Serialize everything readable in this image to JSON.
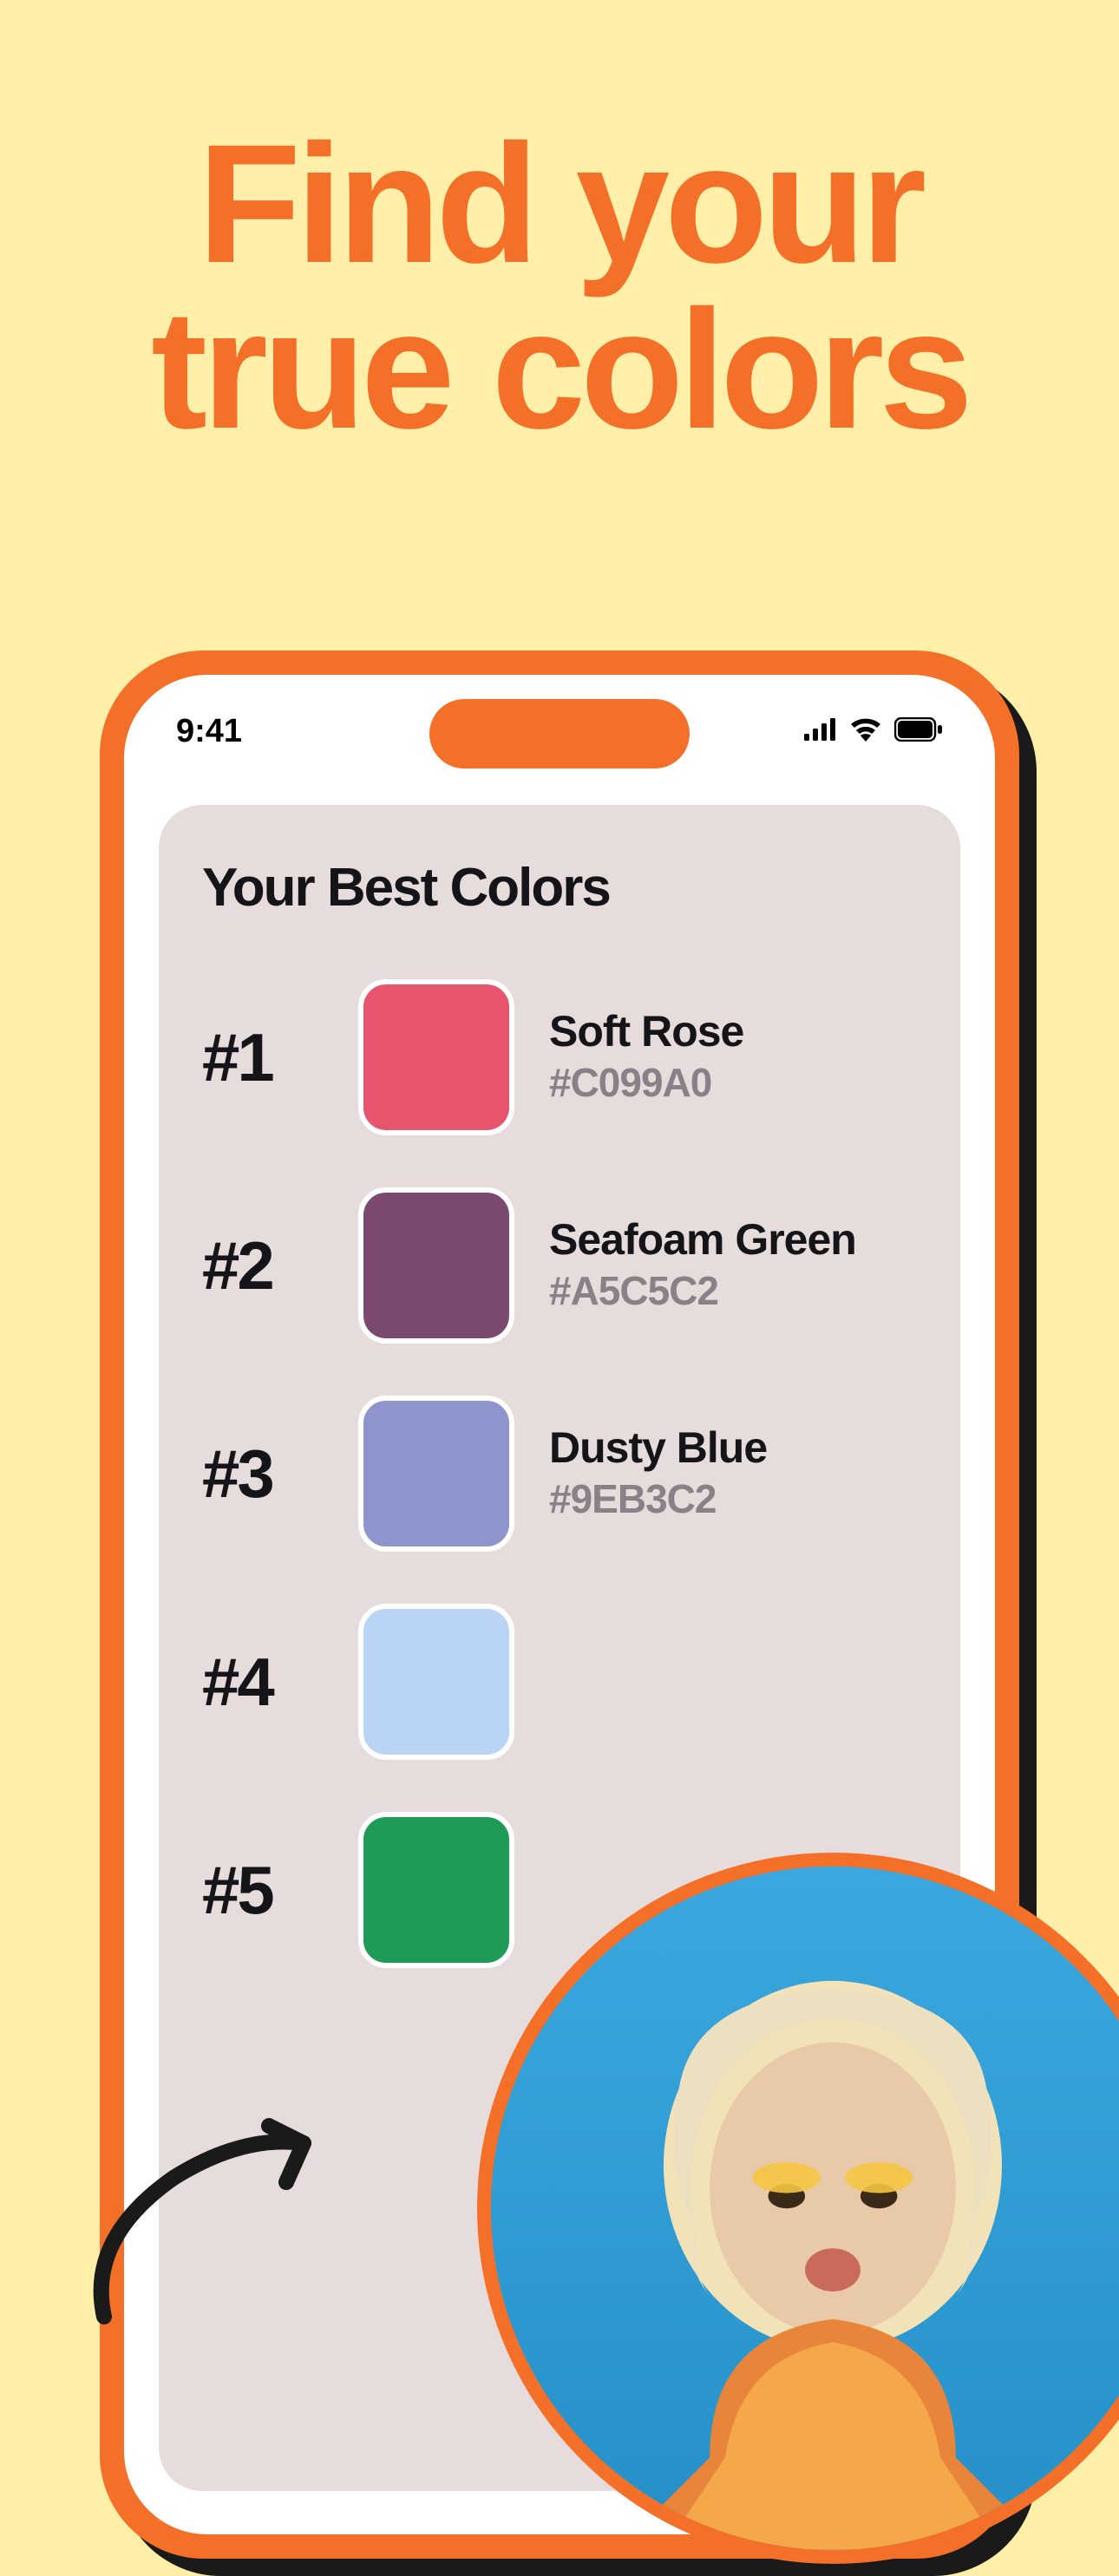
{
  "headline_line1": "Find your",
  "headline_line2": "true colors",
  "status": {
    "time": "9:41"
  },
  "card": {
    "title": "Your Best Colors"
  },
  "colors": [
    {
      "rank": "#1",
      "swatch": "#E8546E",
      "name": "Soft Rose",
      "hex": "#C099A0"
    },
    {
      "rank": "#2",
      "swatch": "#7B4A6E",
      "name": "Seafoam Green",
      "hex": "#A5C5C2"
    },
    {
      "rank": "#3",
      "swatch": "#8E94CC",
      "name": "Dusty Blue",
      "hex": "#9EB3C2"
    },
    {
      "rank": "#4",
      "swatch": "#BAD4F5",
      "name": "",
      "hex": ""
    },
    {
      "rank": "#5",
      "swatch": "#1E9C57",
      "name": "",
      "hex": ""
    }
  ]
}
